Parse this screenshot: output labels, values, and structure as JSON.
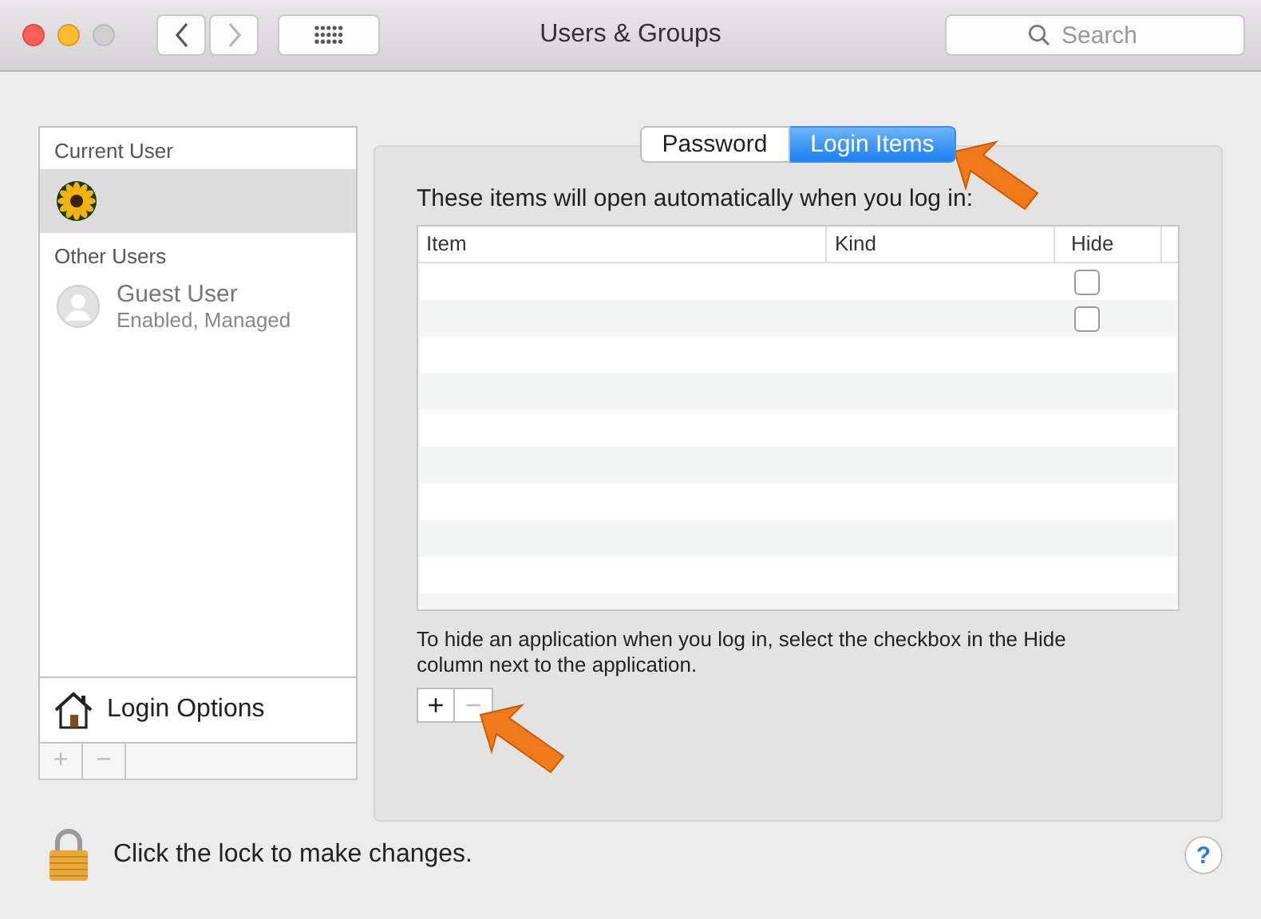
{
  "window": {
    "title": "Users & Groups",
    "traffic_lights": [
      {
        "kind": "close",
        "disabled": false
      },
      {
        "kind": "minimize",
        "disabled": false
      },
      {
        "kind": "zoom",
        "disabled": true
      }
    ]
  },
  "nav_buttons": [
    {
      "kind": "back",
      "disabled": false
    },
    {
      "kind": "forward",
      "disabled": true
    }
  ],
  "search": {
    "placeholder": "Search"
  },
  "sidebar": {
    "sections": [
      {
        "title": "Current User",
        "users": [
          {
            "kind": "flower",
            "selected": true
          }
        ]
      },
      {
        "title": "Other Users",
        "users": [
          {
            "name": "Guest User",
            "detail": "Enabled, Managed",
            "kind": "generic",
            "selected": false
          }
        ]
      }
    ],
    "login_options": "Login Options",
    "buttons": [
      {
        "label": "+",
        "disabled": true
      },
      {
        "label": "−",
        "disabled": true
      }
    ]
  },
  "tabs": [
    {
      "label": "Password",
      "selected": false
    },
    {
      "label": "Login Items",
      "selected": true
    }
  ],
  "intro": "These items will open automatically when you log in:",
  "table": {
    "columns": [
      "Item",
      "Kind",
      "Hide"
    ],
    "rows": [
      {
        "hide": false
      },
      {
        "hide": false
      }
    ]
  },
  "hint": "To hide an application when you log in, select the checkbox in the Hide column next to the application.",
  "item_buttons": [
    {
      "label": "+",
      "disabled": false
    },
    {
      "label": "−",
      "disabled": true
    }
  ],
  "lock_text": "Click the lock to make changes.",
  "help": "?"
}
